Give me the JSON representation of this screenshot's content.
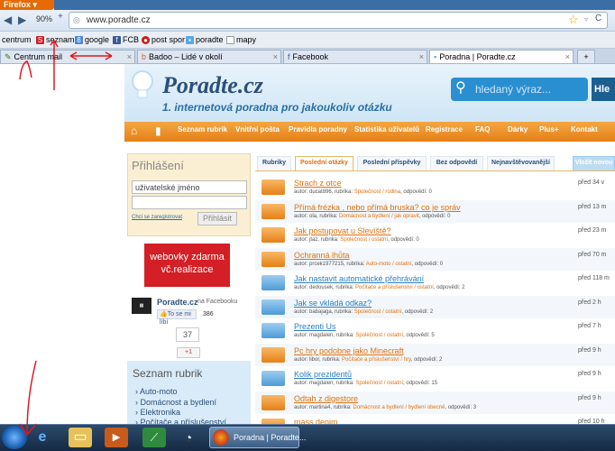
{
  "browser": {
    "app_button": "Firefox",
    "zoom": "90%",
    "url": "www.poradte.cz",
    "bookmarks": [
      "centrum",
      "seznam",
      "google",
      "FCB",
      "post spor",
      "poradte",
      "mapy"
    ],
    "tabs": [
      {
        "label": "Centrum mail"
      },
      {
        "label": "Badoo – Lidé v okolí"
      },
      {
        "label": "Facebook"
      },
      {
        "label": "Poradna | Poradte.cz"
      }
    ],
    "new_tab": "+"
  },
  "site": {
    "logo": "Poradte.cz",
    "tagline": "1. internetová poradna pro jakoukoliv otázku",
    "search_placeholder": "hledaný výraz...",
    "search_button": "Hle",
    "menu": [
      "Seznam rubrik",
      "Vnitřní pošta",
      "Pravidla poradny",
      "Statistika uživatelů",
      "Registrace",
      "FAQ",
      "Dárky",
      "Plus+",
      "Kontakt"
    ]
  },
  "login": {
    "title": "Přihlášení",
    "username_value": "uživatelské jméno",
    "password_value": "",
    "register_link": "Chci se zaregistrovat",
    "button": "Přihlásit"
  },
  "promo": {
    "line1": "webovky zdarma",
    "line2": "vč.realizace"
  },
  "facebook": {
    "title": "Poradte.cz",
    "sub": "na Facebooku",
    "like": "To se mi líbí",
    "likes": "386",
    "plus_count": "37",
    "plus_button": "+1"
  },
  "rubrics": {
    "title": "Seznam rubrik",
    "items": [
      "Auto-moto",
      "Domácnost a bydlení",
      "Elektronika",
      "Počítače a příslušenství"
    ]
  },
  "content_tabs": [
    "Rubriky",
    "Poslední otázky",
    "Poslední příspěvky",
    "Bez odpovědí",
    "Nejnavštěvovanější",
    "Vložit novou"
  ],
  "questions": [
    {
      "title": "Strach z otce",
      "author": "autor: ducat896, rubrika: ",
      "rubric": "Společnost / rodina",
      "answers": ", odpovědí: 0",
      "time": "před 34 v",
      "color": "o"
    },
    {
      "title": "Přímá frézka , nebo přímá bruska? co je správ",
      "author": "autor: ola, rubrika: ",
      "rubric": "Domácnost a bydlení / jak opravit",
      "answers": ", odpovědí: 0",
      "time": "před 13 m",
      "color": "o"
    },
    {
      "title": "Jak postupovat u Slevíště?",
      "author": "autor: jtaz, rubrika: ",
      "rubric": "Společnost / ostatní",
      "answers": ", odpovědí: 0",
      "time": "před 23 m",
      "color": "o"
    },
    {
      "title": "Ochranná lhůta",
      "author": "autor: prcek1977215, rubrika: ",
      "rubric": "Auto-moto / ostatní",
      "answers": ", odpovědí: 0",
      "time": "před 70 m",
      "color": "o"
    },
    {
      "title": "Jak nastavit automatické přehrávání",
      "author": "autor: dedousek, rubrika: ",
      "rubric": "Počítače a příslušenství / ostatní",
      "answers": ", odpovědí: 2",
      "time": "před 118 m",
      "color": "b"
    },
    {
      "title": "Jak se vkládá odkaz?",
      "author": "autor: babajaga, rubrika: ",
      "rubric": "Společnost / ostatní",
      "answers": ", odpovědí: 2",
      "time": "před 2 h",
      "color": "b"
    },
    {
      "title": "Prezenti Us",
      "author": "autor: magdalen, rubrika: ",
      "rubric": "Společnost / ostatní",
      "answers": ", odpovědí: 5",
      "time": "před 7 h",
      "color": "b"
    },
    {
      "title": "Pc hry podobne jako Minecraft",
      "author": "autor: libor, rubrika: ",
      "rubric": "Počítače a příslušenství / hry",
      "answers": ", odpovědí: 2",
      "time": "před 9 h",
      "color": "o"
    },
    {
      "title": "Kolik prezidentů",
      "author": "autor: magdalen, rubrika: ",
      "rubric": "Společnost / ostatní",
      "answers": ", odpovědí: 15",
      "time": "před 9 h",
      "color": "b"
    },
    {
      "title": "Odtah z digestore",
      "author": "autor: martina4, rubrika: ",
      "rubric": "Domácnost a bydlení / bydlení obecně",
      "answers": ", odpovědí: 3",
      "time": "před 9 h",
      "color": "o"
    },
    {
      "title": "mass denim",
      "author": "",
      "rubric": "",
      "answers": "",
      "time": "před 10 h",
      "color": "o"
    }
  ],
  "taskbar": {
    "active_task": "Poradna | Poradte..."
  },
  "colors": {
    "accent_orange": "#e57f16",
    "brand_blue": "#2a4f7a",
    "annotation_red": "#e0191f"
  }
}
